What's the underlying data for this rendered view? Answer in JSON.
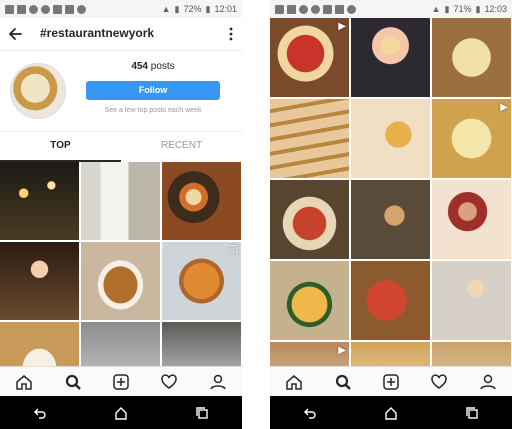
{
  "left": {
    "statusbar": {
      "battery": "72%",
      "time": "12:01"
    },
    "topbar": {
      "title": "#restaurantnewyork"
    },
    "profile": {
      "post_count": "454",
      "post_label": "posts",
      "follow_label": "Follow",
      "hint": "See a few top posts each week"
    },
    "tabs": [
      {
        "label": "TOP"
      },
      {
        "label": "RECENT"
      }
    ]
  },
  "right": {
    "statusbar": {
      "battery": "71%",
      "time": "12:03"
    }
  },
  "colors": {
    "accent": "#3897f0",
    "text": "#262626",
    "muted": "#999999"
  },
  "icons": [
    "back-arrow-icon",
    "more-vert-icon",
    "home-icon",
    "search-icon",
    "add-icon",
    "heart-icon",
    "profile-icon",
    "android-back-icon",
    "android-home-icon",
    "android-recents-icon",
    "video-icon",
    "multi-photo-icon"
  ]
}
